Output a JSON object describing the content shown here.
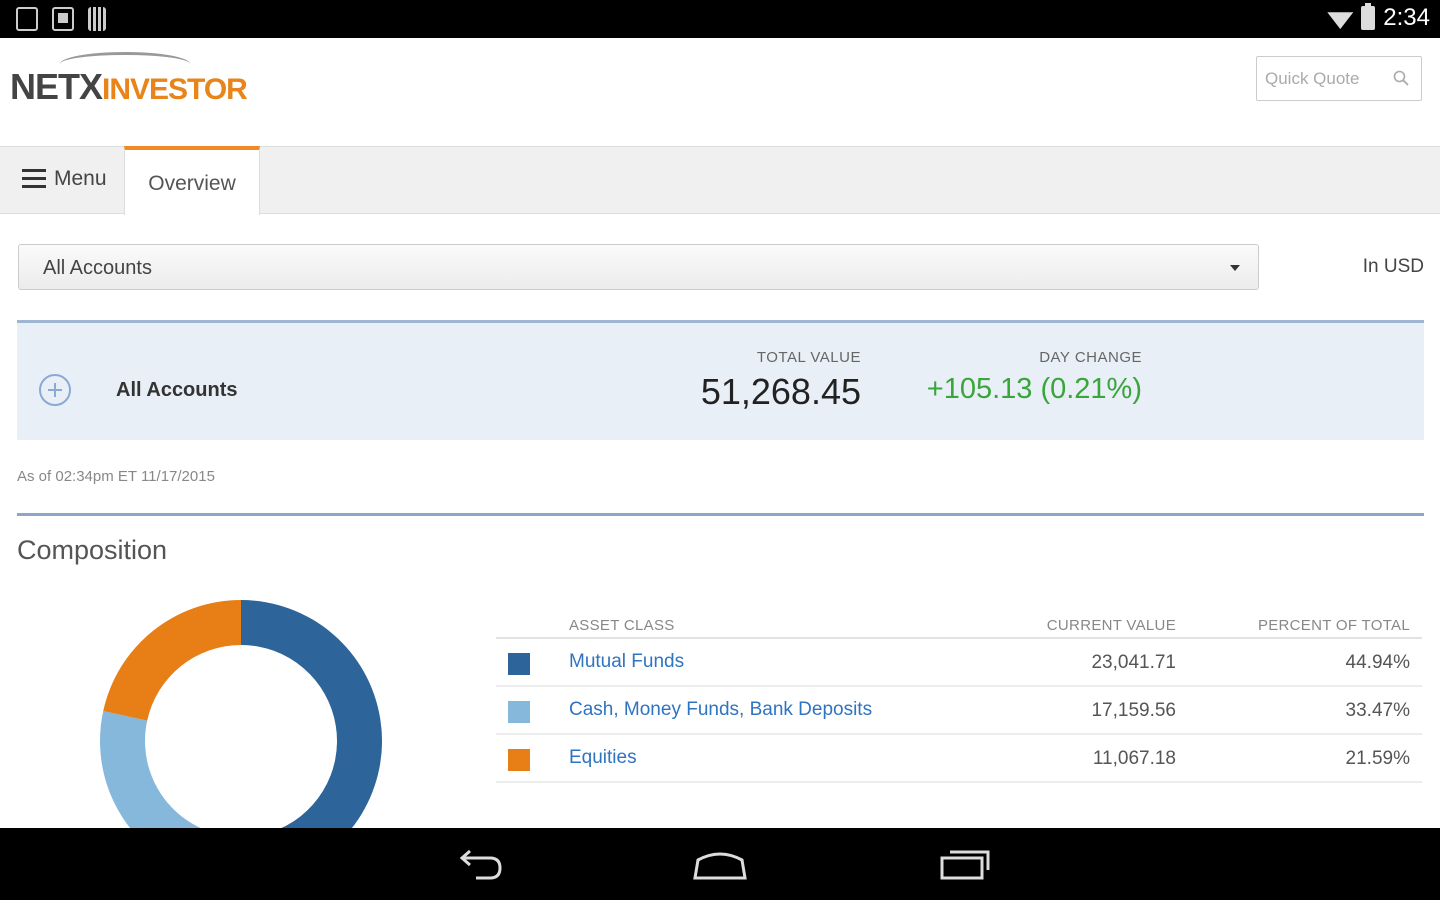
{
  "status_bar": {
    "time": "2:34"
  },
  "header": {
    "logo": {
      "part1": "NETX",
      "part2": "INVESTOR"
    },
    "quick_quote": {
      "placeholder": "Quick Quote"
    }
  },
  "tabs": {
    "menu_label": "Menu",
    "overview_label": "Overview"
  },
  "account_select": {
    "selected": "All Accounts"
  },
  "currency_label": "In USD",
  "summary": {
    "account_name": "All Accounts",
    "total_value_label": "TOTAL VALUE",
    "total_value": "51,268.45",
    "day_change_label": "DAY CHANGE",
    "day_change": "+105.13 (0.21%)"
  },
  "as_of": "As of 02:34pm ET 11/17/2015",
  "composition": {
    "title": "Composition",
    "headers": {
      "asset_class": "ASSET CLASS",
      "current_value": "CURRENT VALUE",
      "percent_of_total": "PERCENT OF TOTAL"
    },
    "rows": [
      {
        "asset_class": "Mutual Funds",
        "current_value": "23,041.71",
        "percent": "44.94%",
        "color": "#2d6499"
      },
      {
        "asset_class": "Cash, Money Funds, Bank Deposits",
        "current_value": "17,159.56",
        "percent": "33.47%",
        "color": "#86b8db"
      },
      {
        "asset_class": "Equities",
        "current_value": "11,067.18",
        "percent": "21.59%",
        "color": "#e77e16"
      }
    ]
  },
  "chart_data": {
    "type": "pie",
    "categories": [
      "Mutual Funds",
      "Cash, Money Funds, Bank Deposits",
      "Equities"
    ],
    "values": [
      44.94,
      33.47,
      21.59
    ],
    "colors": [
      "#2d6499",
      "#86b8db",
      "#e77e16"
    ],
    "title": "",
    "donut": true
  }
}
